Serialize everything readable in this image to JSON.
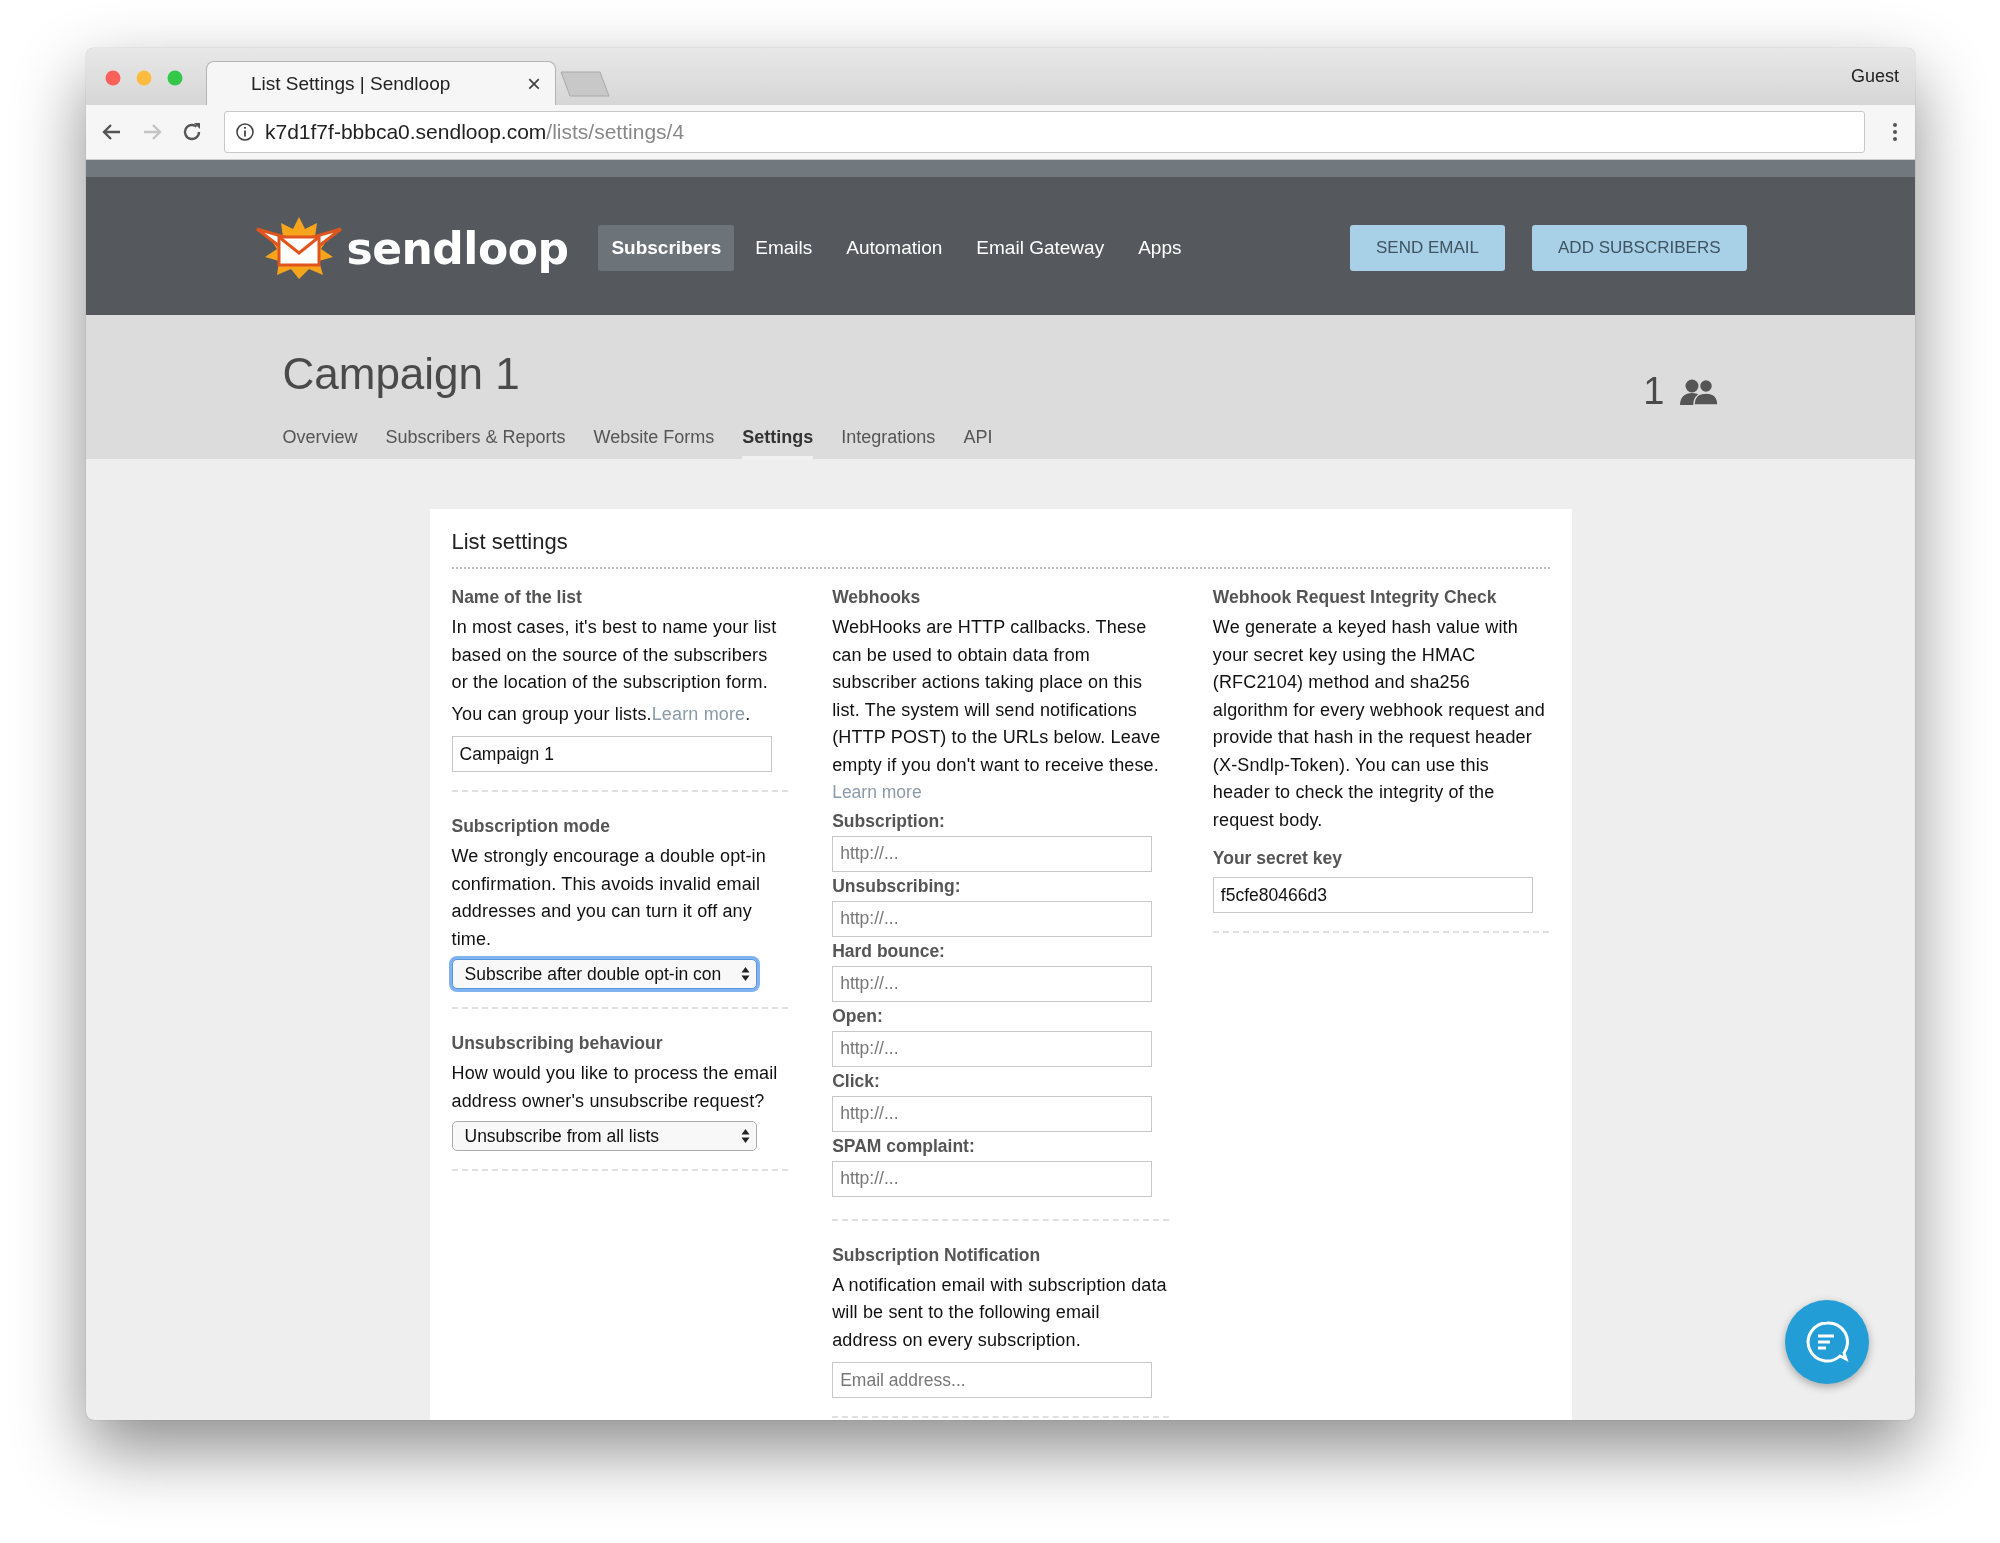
{
  "browser": {
    "tab_title": "List Settings | Sendloop",
    "tab_close": "×",
    "profile": "Guest",
    "url_host": "k7d1f7f-bbbca0.sendloop.com",
    "url_path": "/lists/settings/4"
  },
  "header": {
    "logo_text": "sendloop",
    "nav": [
      {
        "label": "Subscribers",
        "selected": true
      },
      {
        "label": "Emails",
        "selected": false
      },
      {
        "label": "Automation",
        "selected": false
      },
      {
        "label": "Email Gateway",
        "selected": false
      },
      {
        "label": "Apps",
        "selected": false
      }
    ],
    "actions": [
      "SEND EMAIL",
      "ADD SUBSCRIBERS"
    ]
  },
  "list": {
    "title": "Campaign 1",
    "subscriber_count": "1",
    "tabs": [
      {
        "label": "Overview",
        "selected": false
      },
      {
        "label": "Subscribers & Reports",
        "selected": false
      },
      {
        "label": "Website Forms",
        "selected": false
      },
      {
        "label": "Settings",
        "selected": true
      },
      {
        "label": "Integrations",
        "selected": false
      },
      {
        "label": "API",
        "selected": false
      }
    ]
  },
  "card": {
    "title": "List settings",
    "name_section": {
      "heading": "Name of the list",
      "description": "In most cases, it's best to name your list based on the source of the subscribers or the location of the subscription form.",
      "group_text": "You can group your lists.",
      "group_link": "Learn more",
      "group_after": ".",
      "value": "Campaign 1"
    },
    "subscription_mode": {
      "heading": "Subscription mode",
      "description": "We strongly encourage a double opt-in confirmation. This avoids invalid email addresses and you can turn it off any time.",
      "value": "Subscribe after double opt-in con",
      "focused": true
    },
    "unsubscribing": {
      "heading": "Unsubscribing behaviour",
      "description": "How would you like to process the email address owner's unsubscribe request?",
      "value": "Unsubscribe from all lists",
      "focused": false
    },
    "webhooks": {
      "heading": "Webhooks",
      "description": "WebHooks are HTTP callbacks. These can be used to obtain data from subscriber actions taking place on this list. The system will send notifications (HTTP POST) to the URLs below. Leave empty if you don't want to receive these.",
      "link": "Learn more",
      "fields": [
        {
          "label": "Subscription:",
          "placeholder": "http://..."
        },
        {
          "label": "Unsubscribing:",
          "placeholder": "http://..."
        },
        {
          "label": "Hard bounce:",
          "placeholder": "http://..."
        },
        {
          "label": "Open:",
          "placeholder": "http://..."
        },
        {
          "label": "Click:",
          "placeholder": "http://..."
        },
        {
          "label": "SPAM complaint:",
          "placeholder": "http://..."
        }
      ]
    },
    "notification": {
      "heading": "Subscription Notification",
      "description": "A notification email with subscription data will be sent to the following email address on every subscription.",
      "placeholder": "Email address..."
    },
    "integrity": {
      "heading": "Webhook Request Integrity Check",
      "description": "We generate a keyed hash value with your secret key using the HMAC (RFC2104) method and sha256 algorithm for every webhook request and provide that hash in the request header (X-Sndlp-Token). You can use this header to check the integrity of the request body.",
      "key_label": "Your secret key",
      "key_value": "f5cfe80466d3"
    }
  }
}
